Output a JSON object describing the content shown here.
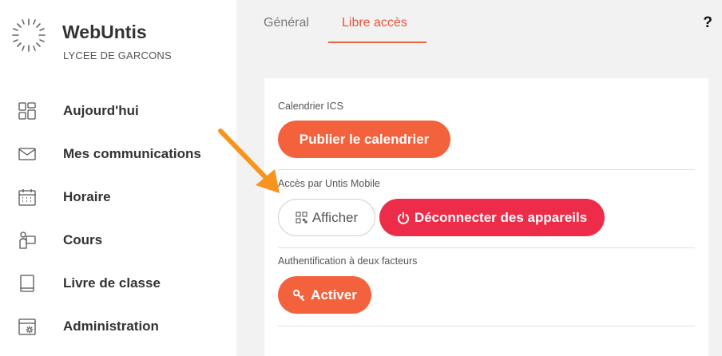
{
  "sidebar": {
    "brand_name": "WebUntis",
    "school_name": "LYCEE DE GARCONS",
    "items": [
      {
        "label": "Aujourd'hui",
        "icon": "dashboard-icon"
      },
      {
        "label": "Mes communications",
        "icon": "mail-icon"
      },
      {
        "label": "Horaire",
        "icon": "calendar-icon"
      },
      {
        "label": "Cours",
        "icon": "person-class-icon"
      },
      {
        "label": "Livre de classe",
        "icon": "book-icon"
      },
      {
        "label": "Administration",
        "icon": "admin-settings-icon"
      }
    ]
  },
  "tabs": [
    {
      "label": "Général",
      "active": false
    },
    {
      "label": "Libre accès",
      "active": true
    }
  ],
  "help_label": "?",
  "sections": {
    "ics": {
      "label": "Calendrier ICS",
      "button": "Publier le calendrier"
    },
    "mobile": {
      "label": "Accès par Untis Mobile",
      "show_button": "Afficher",
      "disconnect_button": "Déconnecter des appareils"
    },
    "twofa": {
      "label": "Authentification à deux facteurs",
      "button": "Activer"
    }
  },
  "colors": {
    "accent": "#f4613d",
    "danger": "#ec2c49",
    "arrow": "#f7941d"
  }
}
